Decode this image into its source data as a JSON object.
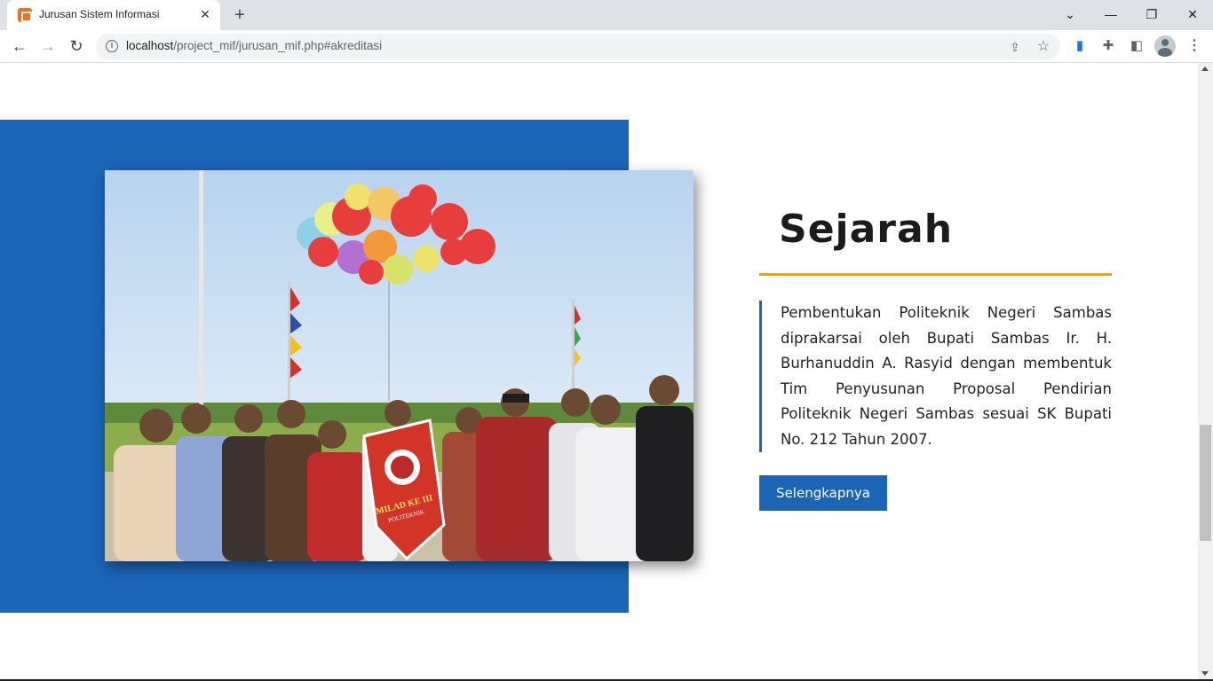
{
  "browser": {
    "tab_title": "Jurusan Sistem Informasi",
    "url_host": "localhost",
    "url_path": "/project_mif/jurusan_mif.php#akreditasi",
    "icons": {
      "favicon": "xampp-icon",
      "close": "close-icon",
      "new_tab": "plus-icon",
      "back": "back-arrow-icon",
      "forward": "forward-arrow-icon",
      "reload": "reload-icon",
      "info": "info-icon",
      "share": "share-icon",
      "bookmark": "star-icon",
      "extensions": "puzzle-icon",
      "side_panel": "side-panel-icon",
      "menu": "kebab-menu-icon"
    }
  },
  "section": {
    "title": "Sejarah",
    "text": "Pembentukan Politeknik Negeri Sambas diprakarsai oleh Bupati Sambas Ir. H. Burhanuddin A. Rasyid dengan membentuk Tim Penyusunan Proposal Pendirian Politeknik Negeri Sambas sesuai SK Bupati No. 212 Tahun 2007.",
    "button_label": "Selengkapnya",
    "photo_banner_text": "MILAD KE III",
    "photo_banner_sub": "POLITEKNIK"
  },
  "colors": {
    "accent_blue": "#1c64b6",
    "underline_gold": "#e8a317"
  }
}
